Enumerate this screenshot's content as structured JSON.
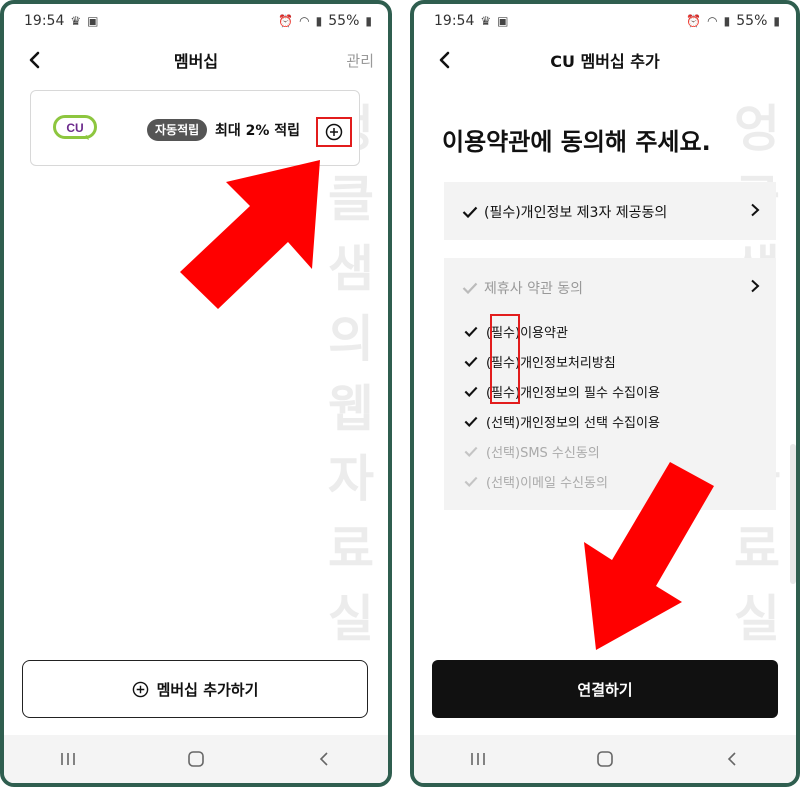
{
  "status": {
    "time": "19:54",
    "battery": "55%"
  },
  "left": {
    "title": "멤버십",
    "manage": "관리",
    "card": {
      "logo_text": "CU",
      "badge": "자동적립",
      "benefit": "최대 2% 적립"
    },
    "add_button": "멤버십 추가하기"
  },
  "right": {
    "title": "CU 멤버십 추가",
    "headline": "이용약관에 동의해 주세요.",
    "consent_main": "(필수)개인정보 제3자 제공동의",
    "consent_group_title": "제휴사 약관 동의",
    "consent_items": [
      {
        "prefix": "(필수)",
        "text": "이용약관",
        "checked": true
      },
      {
        "prefix": "(필수)",
        "text": "개인정보처리방침",
        "checked": true
      },
      {
        "prefix": "(필수)",
        "text": "개인정보의 필수 수집이용",
        "checked": true
      },
      {
        "prefix": "(선택)",
        "text": "개인정보의 선택 수집이용",
        "checked": true
      },
      {
        "prefix": "(선택)",
        "text": "SMS 수신동의",
        "checked": false
      },
      {
        "prefix": "(선택)",
        "text": "이메일 수신동의",
        "checked": false
      }
    ],
    "connect_button": "연결하기"
  },
  "watermark": [
    "엉",
    "클",
    "샘",
    "의",
    "웹",
    "자",
    "료",
    "실"
  ],
  "colors": {
    "frame": "#2f5e4f",
    "highlight": "#e21c1c",
    "arrow": "#ff0000",
    "cu_purple": "#6c2a8c",
    "cu_green": "#8dc63f",
    "primary_button": "#111111"
  }
}
